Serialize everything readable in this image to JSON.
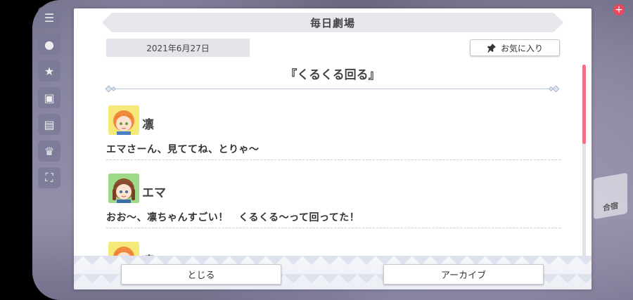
{
  "dialog": {
    "title": "毎日劇場",
    "date": "2021年6月27日",
    "favorite_label": "お気に入り",
    "story_title": "『くるくる回る』",
    "close_label": "とじる",
    "archive_label": "アーカイブ"
  },
  "entries": [
    {
      "speaker": "凛",
      "text": "エマさーん、見ててね、とりゃ〜",
      "avatar_color": "#f5e97a",
      "avatar_icon": "rin-avatar"
    },
    {
      "speaker": "エマ",
      "text": "おお〜、凛ちゃんすごい！　くるくる〜って回ってた！",
      "avatar_color": "#9fd98a",
      "avatar_icon": "emma-avatar"
    },
    {
      "speaker": "凛",
      "text": "",
      "avatar_color": "#f5e97a",
      "avatar_icon": "rin-avatar"
    }
  ],
  "background": {
    "right_tile_label": "合宿"
  },
  "colors": {
    "scroll_thumb": "#f26f86",
    "header_bg": "#e6e7ec",
    "badge": "#e8475e"
  }
}
